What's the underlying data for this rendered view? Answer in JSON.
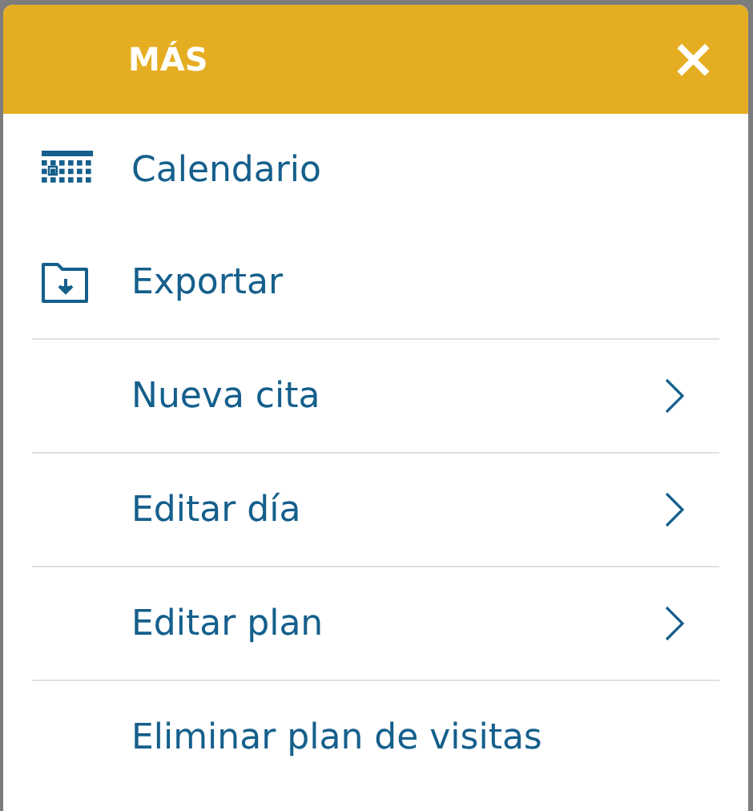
{
  "menu": {
    "title": "MÁS",
    "close": "×",
    "items": [
      {
        "label": "Calendario",
        "kind": "calendar"
      },
      {
        "label": "Exportar",
        "kind": "export"
      },
      {
        "label": "Nueva cita",
        "kind": "submenu"
      },
      {
        "label": "Editar día",
        "kind": "submenu"
      },
      {
        "label": "Editar plan",
        "kind": "submenu"
      },
      {
        "label": "Eliminar plan de visitas",
        "kind": "plain"
      }
    ]
  }
}
